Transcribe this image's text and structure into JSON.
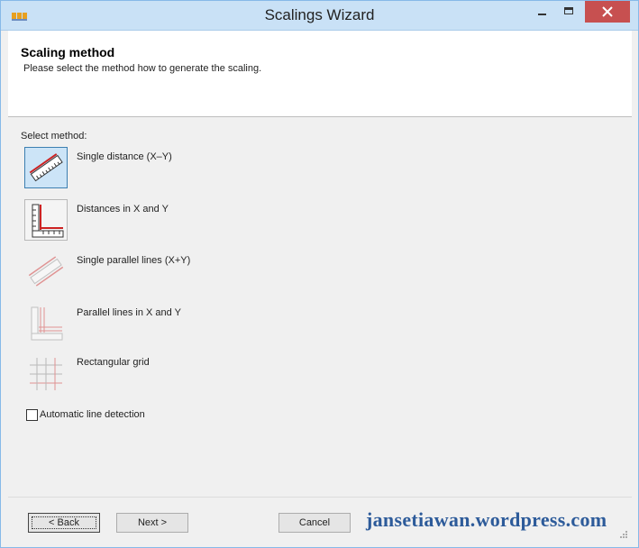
{
  "window": {
    "title": "Scalings Wizard"
  },
  "header": {
    "title": "Scaling method",
    "subtitle": "Please select the method how to generate the scaling."
  },
  "content": {
    "select_label": "Select method:",
    "methods": [
      {
        "label": "Single distance (X–Y)",
        "icon": "single-distance-icon",
        "selected": true,
        "enabled": true
      },
      {
        "label": "Distances in X and Y",
        "icon": "distances-xy-icon",
        "selected": false,
        "enabled": true
      },
      {
        "label": "Single parallel lines (X+Y)",
        "icon": "single-parallel-lines-icon",
        "selected": false,
        "enabled": false
      },
      {
        "label": "Parallel lines in X and Y",
        "icon": "parallel-lines-xy-icon",
        "selected": false,
        "enabled": false
      },
      {
        "label": "Rectangular grid",
        "icon": "rectangular-grid-icon",
        "selected": false,
        "enabled": false
      }
    ],
    "auto_detect": {
      "label": "Automatic line detection",
      "checked": false
    }
  },
  "footer": {
    "back_label": "< Back",
    "next_label": "Next >",
    "cancel_label": "Cancel",
    "watermark": "jansetiawan.wordpress.com"
  },
  "colors": {
    "accent": "#3c7fb1",
    "close": "#c75050",
    "titlebar": "#c9e1f6",
    "scale_red": "#cc2222"
  }
}
